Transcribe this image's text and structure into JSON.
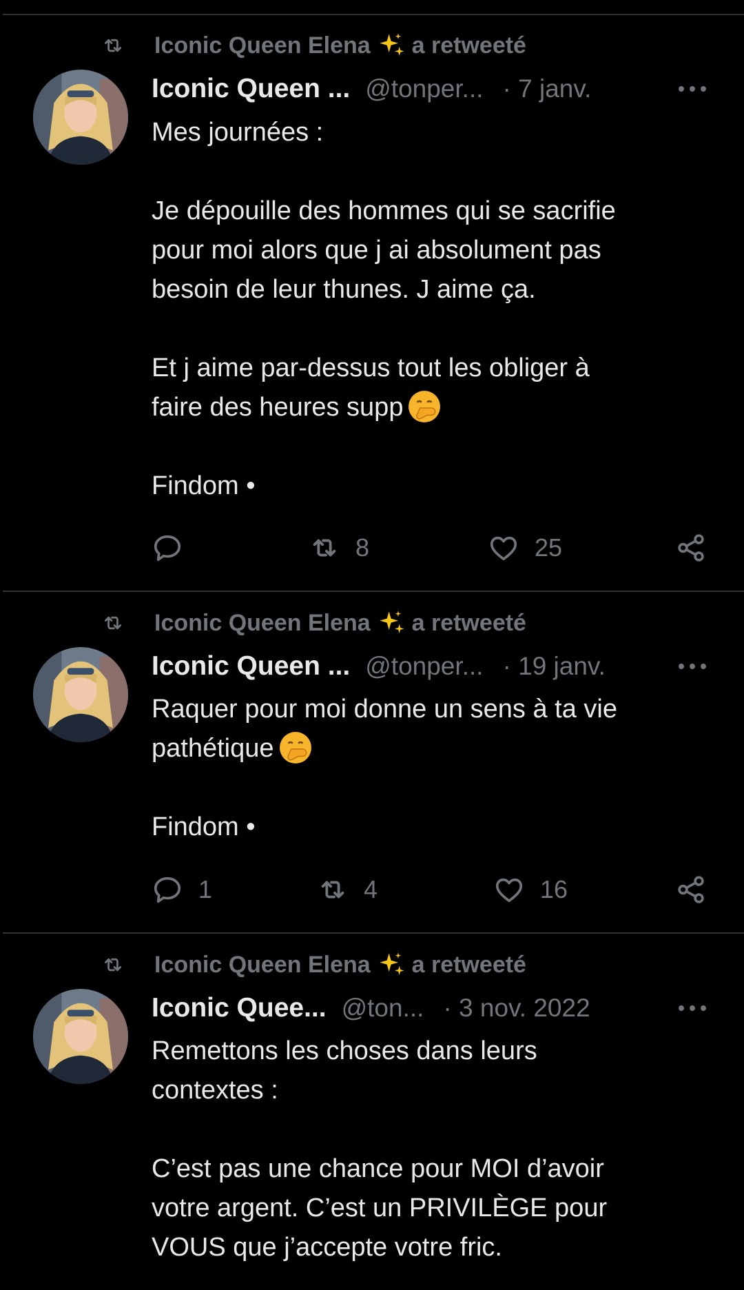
{
  "colors": {
    "background": "#000000",
    "text": "#e7e9ea",
    "muted": "#71767b",
    "divider": "#2f3336"
  },
  "tweets": [
    {
      "retweeter": "Iconic Queen Elena",
      "retweet_suffix": "a retweeté",
      "name": "Iconic Queen ...",
      "handle": "@tonper...",
      "date": "· 7 janv.",
      "text": "Mes journées :\n\nJe dépouille des hommes qui se sacrifie\npour moi alors que j ai absolument pas\nbesoin de leur thunes. J aime ça.\n\nEt j aime par-dessus tout les obliger à\nfaire des heures supp",
      "text_tail": "\n\nFindom •",
      "emoji": "face-with-hand-over-mouth",
      "replies": "",
      "retweets": "8",
      "likes": "25"
    },
    {
      "retweeter": "Iconic Queen Elena",
      "retweet_suffix": "a retweeté",
      "name": "Iconic Queen ...",
      "handle": "@tonper...",
      "date": "· 19 janv.",
      "text": "Raquer pour moi donne un sens à ta vie\npathétique",
      "text_tail": "\n\nFindom •",
      "emoji": "face-with-hand-over-mouth",
      "replies": "1",
      "retweets": "4",
      "likes": "16"
    },
    {
      "retweeter": "Iconic Queen Elena",
      "retweet_suffix": "a retweeté",
      "name": "Iconic Quee...",
      "handle": "@ton...",
      "date": "· 3 nov. 2022",
      "text": "Remettons les choses dans leurs\ncontextes :\n\nC’est pas une chance pour MOI d’avoir\nvotre argent. C’est un PRIVILÈGE pour\nVOUS que j’accepte votre fric.",
      "text_tail": "",
      "emoji": "",
      "replies": "",
      "retweets": "",
      "likes": ""
    }
  ]
}
